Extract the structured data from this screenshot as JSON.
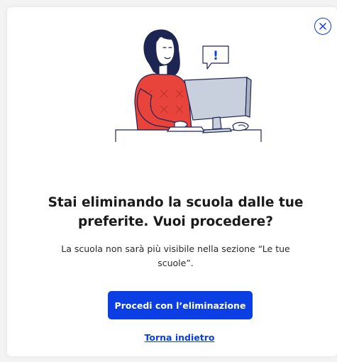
{
  "dialog": {
    "close_icon": "close-icon",
    "illustration_icon": "person-at-computer-illustration",
    "alert_mark": "!",
    "title": "Stai eliminando la scuola dalle tue preferite. Vuoi procedere?",
    "message": "La scuola non sarà più visibile nella sezione “Le tue scuole”.",
    "confirm_label": "Procedi con l’eliminazione",
    "back_label": "Torna indietro"
  },
  "colors": {
    "accent": "#0b3ee3",
    "illustration_sweater": "#e8443b",
    "illustration_hair": "#1d2553",
    "illustration_monitor": "#c9d0dd"
  }
}
